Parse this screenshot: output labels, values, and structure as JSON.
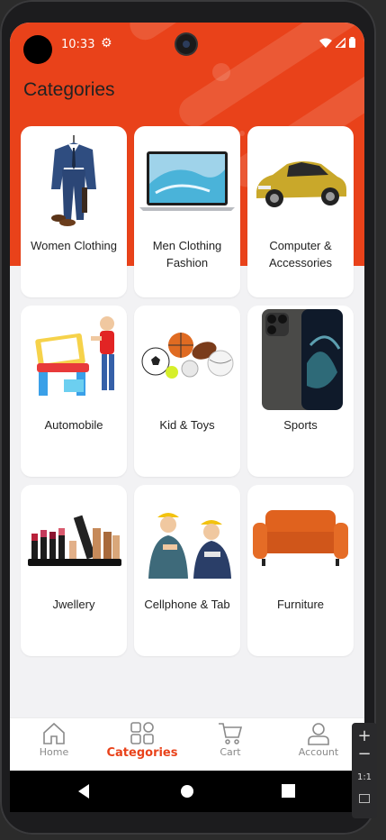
{
  "status": {
    "time": "10:33"
  },
  "page": {
    "title": "Categories"
  },
  "colors": {
    "accent": "#e9421a",
    "background": "#f2f2f4"
  },
  "categories": [
    {
      "label": "Women Clothing",
      "image": "suit-image"
    },
    {
      "label": "Men Clothing Fashion",
      "image": "laptop-image"
    },
    {
      "label": "Computer & Accessories",
      "image": "car-image"
    },
    {
      "label": "Automobile",
      "image": "kid-drawing-desk-image"
    },
    {
      "label": "Kid & Toys",
      "image": "sport-balls-image"
    },
    {
      "label": "Sports",
      "image": "smartphone-image"
    },
    {
      "label": "Jwellery",
      "image": "cosmetics-image"
    },
    {
      "label": "Cellphone & Tab",
      "image": "workers-image"
    },
    {
      "label": "Furniture",
      "image": "sofa-image"
    }
  ],
  "bottom_nav": {
    "items": [
      {
        "label": "Home",
        "icon": "home-icon"
      },
      {
        "label": "Categories",
        "icon": "grid-icon",
        "active": true
      },
      {
        "label": "Cart",
        "icon": "cart-icon"
      },
      {
        "label": "Account",
        "icon": "user-icon"
      }
    ]
  },
  "emulator_panel": {
    "zoom_label": "1:1"
  }
}
